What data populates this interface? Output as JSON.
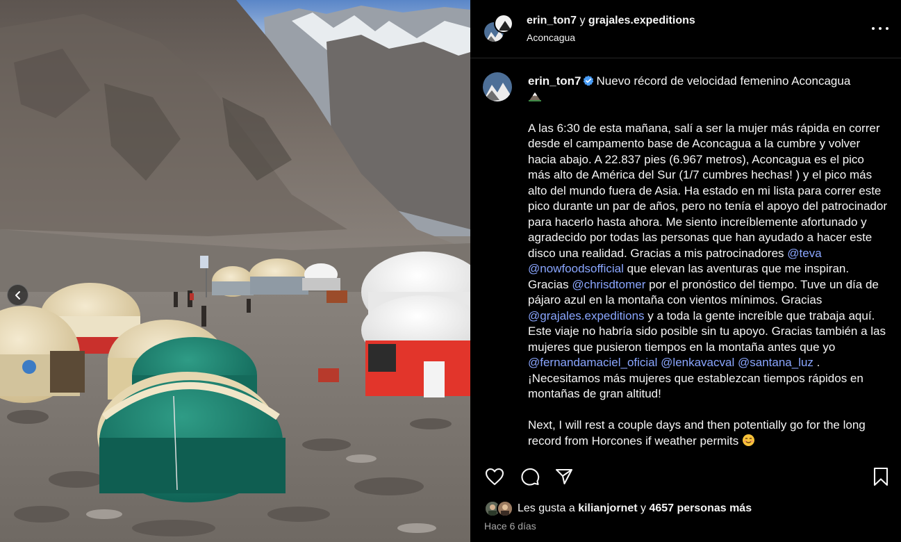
{
  "media": {
    "image_description_icon": "mountain-camp-photo",
    "carousel_prev_icon": "chevron-left-icon"
  },
  "header": {
    "user1": "erin_ton7",
    "separator": "y",
    "user2": "grajales.expeditions",
    "location": "Aconcagua",
    "more_icon": "more-horizontal-icon"
  },
  "caption": {
    "username": "erin_ton7",
    "verified_icon": "verified-badge-icon",
    "title": "Nuevo récord de velocidad femenino Aconcagua",
    "title_emoji": "mountain-emoji",
    "p1_a": "A las 6:30 de esta mañana, salí a ser la mujer más rápida en correr desde el campamento base de Aconcagua a la cumbre y volver hacia abajo. A 22.837 pies (6.967 metros), Aconcagua es el pico más alto de América del Sur (1/7 cumbres hechas! ) y el pico más alto del mundo fuera de Asia. Ha estado en mi lista para correr este pico durante un par de años, pero no tenía el apoyo del patrocinador para hacerlo hasta ahora. Me siento increíblemente afortunado y agradecido por todas las personas que han ayudado a hacer este disco una realidad. Gracias a mis patrocinadores",
    "m_teva": "@teva",
    "m_nowfoods": "@nowfoodsofficial",
    "p1_b": "que elevan las aventuras que me inspiran. Gracias",
    "m_chrisdtomer": "@chrisdtomer",
    "p1_c": "por el pronóstico del tiempo. Tuve un día de pájaro azul en la montaña con vientos mínimos. Gracias",
    "m_grajales": "@grajales.expeditions",
    "p1_d": "y a toda la gente increíble que trabaja aquí. Este viaje no habría sido posible sin tu apoyo. Gracias también a las mujeres que pusieron tiempos en la montaña antes que yo",
    "m_fernanda": "@fernandamaciel_oficial",
    "m_lenka": "@lenkavacval",
    "m_santana": "@santana_luz",
    "p1_e": ". ¡Necesitamos más mujeres que establezcan tiempos rápidos en montañas de gran altitud!",
    "p2": "Next, I will rest a couple days and then potentially go for the long record from Horcones if weather permits",
    "p2_emoji": "smiling-face-emoji"
  },
  "actions": {
    "like_icon": "heart-icon",
    "comment_icon": "comment-icon",
    "share_icon": "share-icon",
    "save_icon": "bookmark-icon"
  },
  "likes": {
    "prefix": "Les gusta a",
    "liker": "kilianjornet",
    "connector": "y",
    "others": "4657 personas más"
  },
  "timestamp": "Hace 6 días",
  "colors": {
    "background": "#000000",
    "text": "#f5f5f5",
    "mention": "#8aa6ff",
    "muted": "#a8a8a8",
    "verified": "#4a9df6",
    "divider": "#262626"
  }
}
